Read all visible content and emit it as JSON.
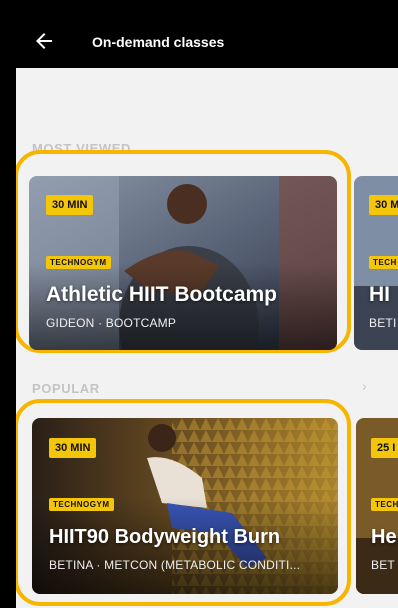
{
  "header": {
    "title": "On-demand classes",
    "back_icon": "arrow-left-icon"
  },
  "sections": {
    "most_viewed": {
      "label": "MOST VIEWED",
      "cards": [
        {
          "duration": "30 MIN",
          "brand": "TECHNOGYM",
          "title": "Athletic HIIT Bootcamp",
          "subtitle": "GIDEON  · BOOTCAMP"
        },
        {
          "duration": "30 M",
          "brand": "TECH",
          "title": "HI",
          "subtitle": "BETI"
        }
      ]
    },
    "popular": {
      "label": "POPULAR",
      "chevron": "›",
      "cards": [
        {
          "duration": "30 MIN",
          "brand": "TECHNOGYM",
          "title": "HIIT90 Bodyweight Burn",
          "subtitle": "BETINA  · METCON (METABOLIC CONDITI..."
        },
        {
          "duration": "25 I",
          "brand": "TECH",
          "title": "He",
          "subtitle": "BET"
        }
      ]
    }
  },
  "colors": {
    "highlight_ring": "#f7b500",
    "badge": "#f4c60a",
    "background": "#f2f2f2"
  }
}
